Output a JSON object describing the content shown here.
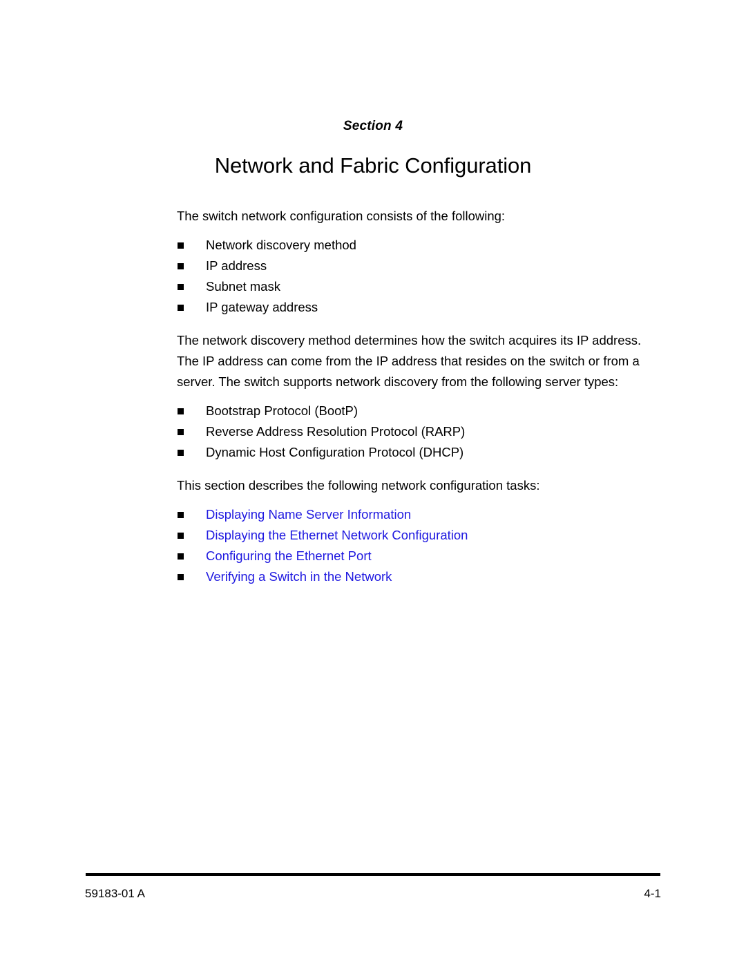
{
  "document": {
    "section_label": "Section",
    "section_number": "4",
    "title": "Network and Fabric Configuration"
  },
  "body": {
    "intro_paragraph": "The switch network configuration consists of the following:",
    "config_items": [
      "Network discovery method",
      "IP address",
      "Subnet mask",
      "IP gateway address"
    ],
    "discovery_paragraph": "The network discovery method determines how the switch acquires its IP address. The IP address can come from the IP address that resides on the switch or from a server. The switch supports network discovery from the following server types:",
    "server_types": [
      "Bootstrap Protocol (BootP)",
      "Reverse Address Resolution Protocol (RARP)",
      "Dynamic Host Configuration Protocol (DHCP)"
    ],
    "tasks_paragraph": "This section describes the following network configuration tasks:",
    "task_links": [
      "Displaying Name Server Information",
      "Displaying the Ethernet Network Configuration",
      "Configuring the Ethernet Port",
      "Verifying a Switch in the Network"
    ],
    "link_color": "#1e18e0",
    "bullet_color": "#000000"
  },
  "footer": {
    "document_number": "59183-01 A",
    "page_number": "4-1"
  }
}
